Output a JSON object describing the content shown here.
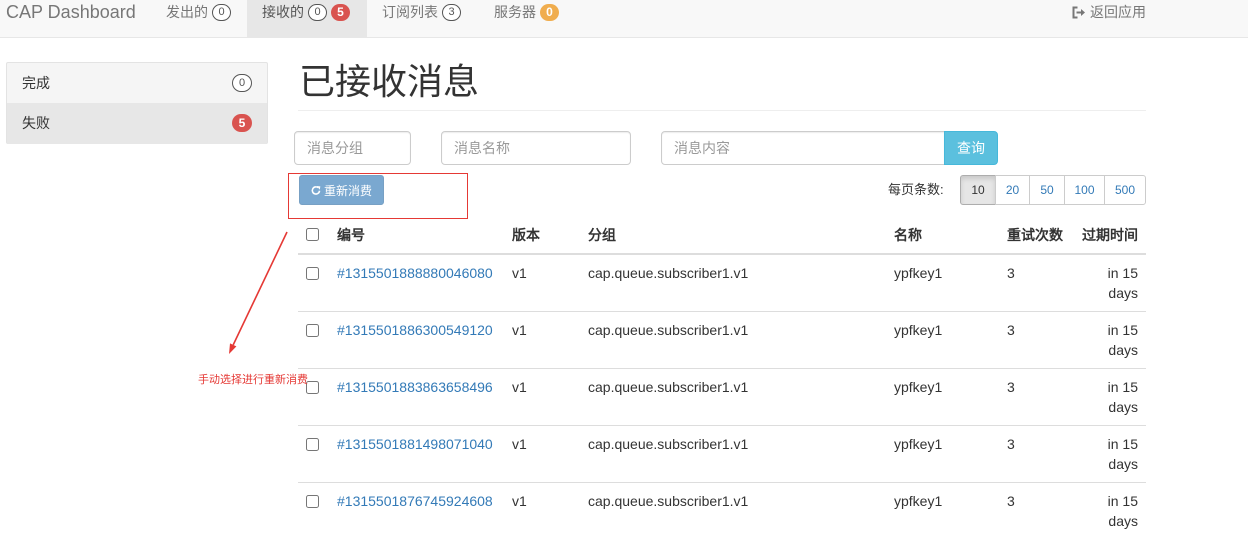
{
  "colors": {
    "navbar_bg": "#f8f8f8",
    "nav_active_bg": "#e7e7e7",
    "badge_danger": "#d9534f",
    "badge_warning": "#f0ad4e",
    "link": "#337ab7",
    "search_button": "#5bc0de",
    "requeue_button": "#7aa8d0",
    "annotation": "#e53935"
  },
  "navbar": {
    "brand": "CAP Dashboard",
    "items": [
      {
        "label": "发出的",
        "badges": [
          "0"
        ],
        "active": false
      },
      {
        "label": "接收的",
        "badges": [
          "0",
          "5"
        ],
        "active": true
      },
      {
        "label": "订阅列表",
        "badges": [
          "3"
        ],
        "active": false
      },
      {
        "label": "服务器",
        "badges": [
          "0"
        ],
        "active": false
      }
    ],
    "back_link": {
      "label": "返回应用",
      "icon": "sign-out-icon"
    }
  },
  "sidebar": {
    "items": [
      {
        "label": "完成",
        "badge": "0",
        "active": false
      },
      {
        "label": "失败",
        "badge": "5",
        "active": true
      }
    ]
  },
  "main": {
    "title": "已接收消息",
    "filters": {
      "group_placeholder": "消息分组",
      "group_value": "",
      "name_placeholder": "消息名称",
      "name_value": "",
      "content_placeholder": "消息内容",
      "content_value": "",
      "search_label": "查询"
    },
    "requeue": {
      "label": "重新消费",
      "icon": "refresh-icon"
    },
    "page_size": {
      "label": "每页条数:",
      "options": [
        "10",
        "20",
        "50",
        "100",
        "500"
      ],
      "selected": "10"
    },
    "table": {
      "headers": {
        "id": "编号",
        "version": "版本",
        "group": "分组",
        "name": "名称",
        "retries": "重试次数",
        "expires": "过期时间"
      },
      "rows": [
        {
          "id": "#1315501888880046080",
          "version": "v1",
          "group": "cap.queue.subscriber1.v1",
          "name": "ypfkey1",
          "retries": "3",
          "expires": "in 15 days",
          "checked": false
        },
        {
          "id": "#1315501886300549120",
          "version": "v1",
          "group": "cap.queue.subscriber1.v1",
          "name": "ypfkey1",
          "retries": "3",
          "expires": "in 15 days",
          "checked": false
        },
        {
          "id": "#1315501883863658496",
          "version": "v1",
          "group": "cap.queue.subscriber1.v1",
          "name": "ypfkey1",
          "retries": "3",
          "expires": "in 15 days",
          "checked": false
        },
        {
          "id": "#1315501881498071040",
          "version": "v1",
          "group": "cap.queue.subscriber1.v1",
          "name": "ypfkey1",
          "retries": "3",
          "expires": "in 15 days",
          "checked": false
        },
        {
          "id": "#1315501876745924608",
          "version": "v1",
          "group": "cap.queue.subscriber1.v1",
          "name": "ypfkey1",
          "retries": "3",
          "expires": "in 15 days",
          "checked": false
        }
      ]
    }
  },
  "annotation": {
    "text": "手动选择进行重新消费"
  }
}
